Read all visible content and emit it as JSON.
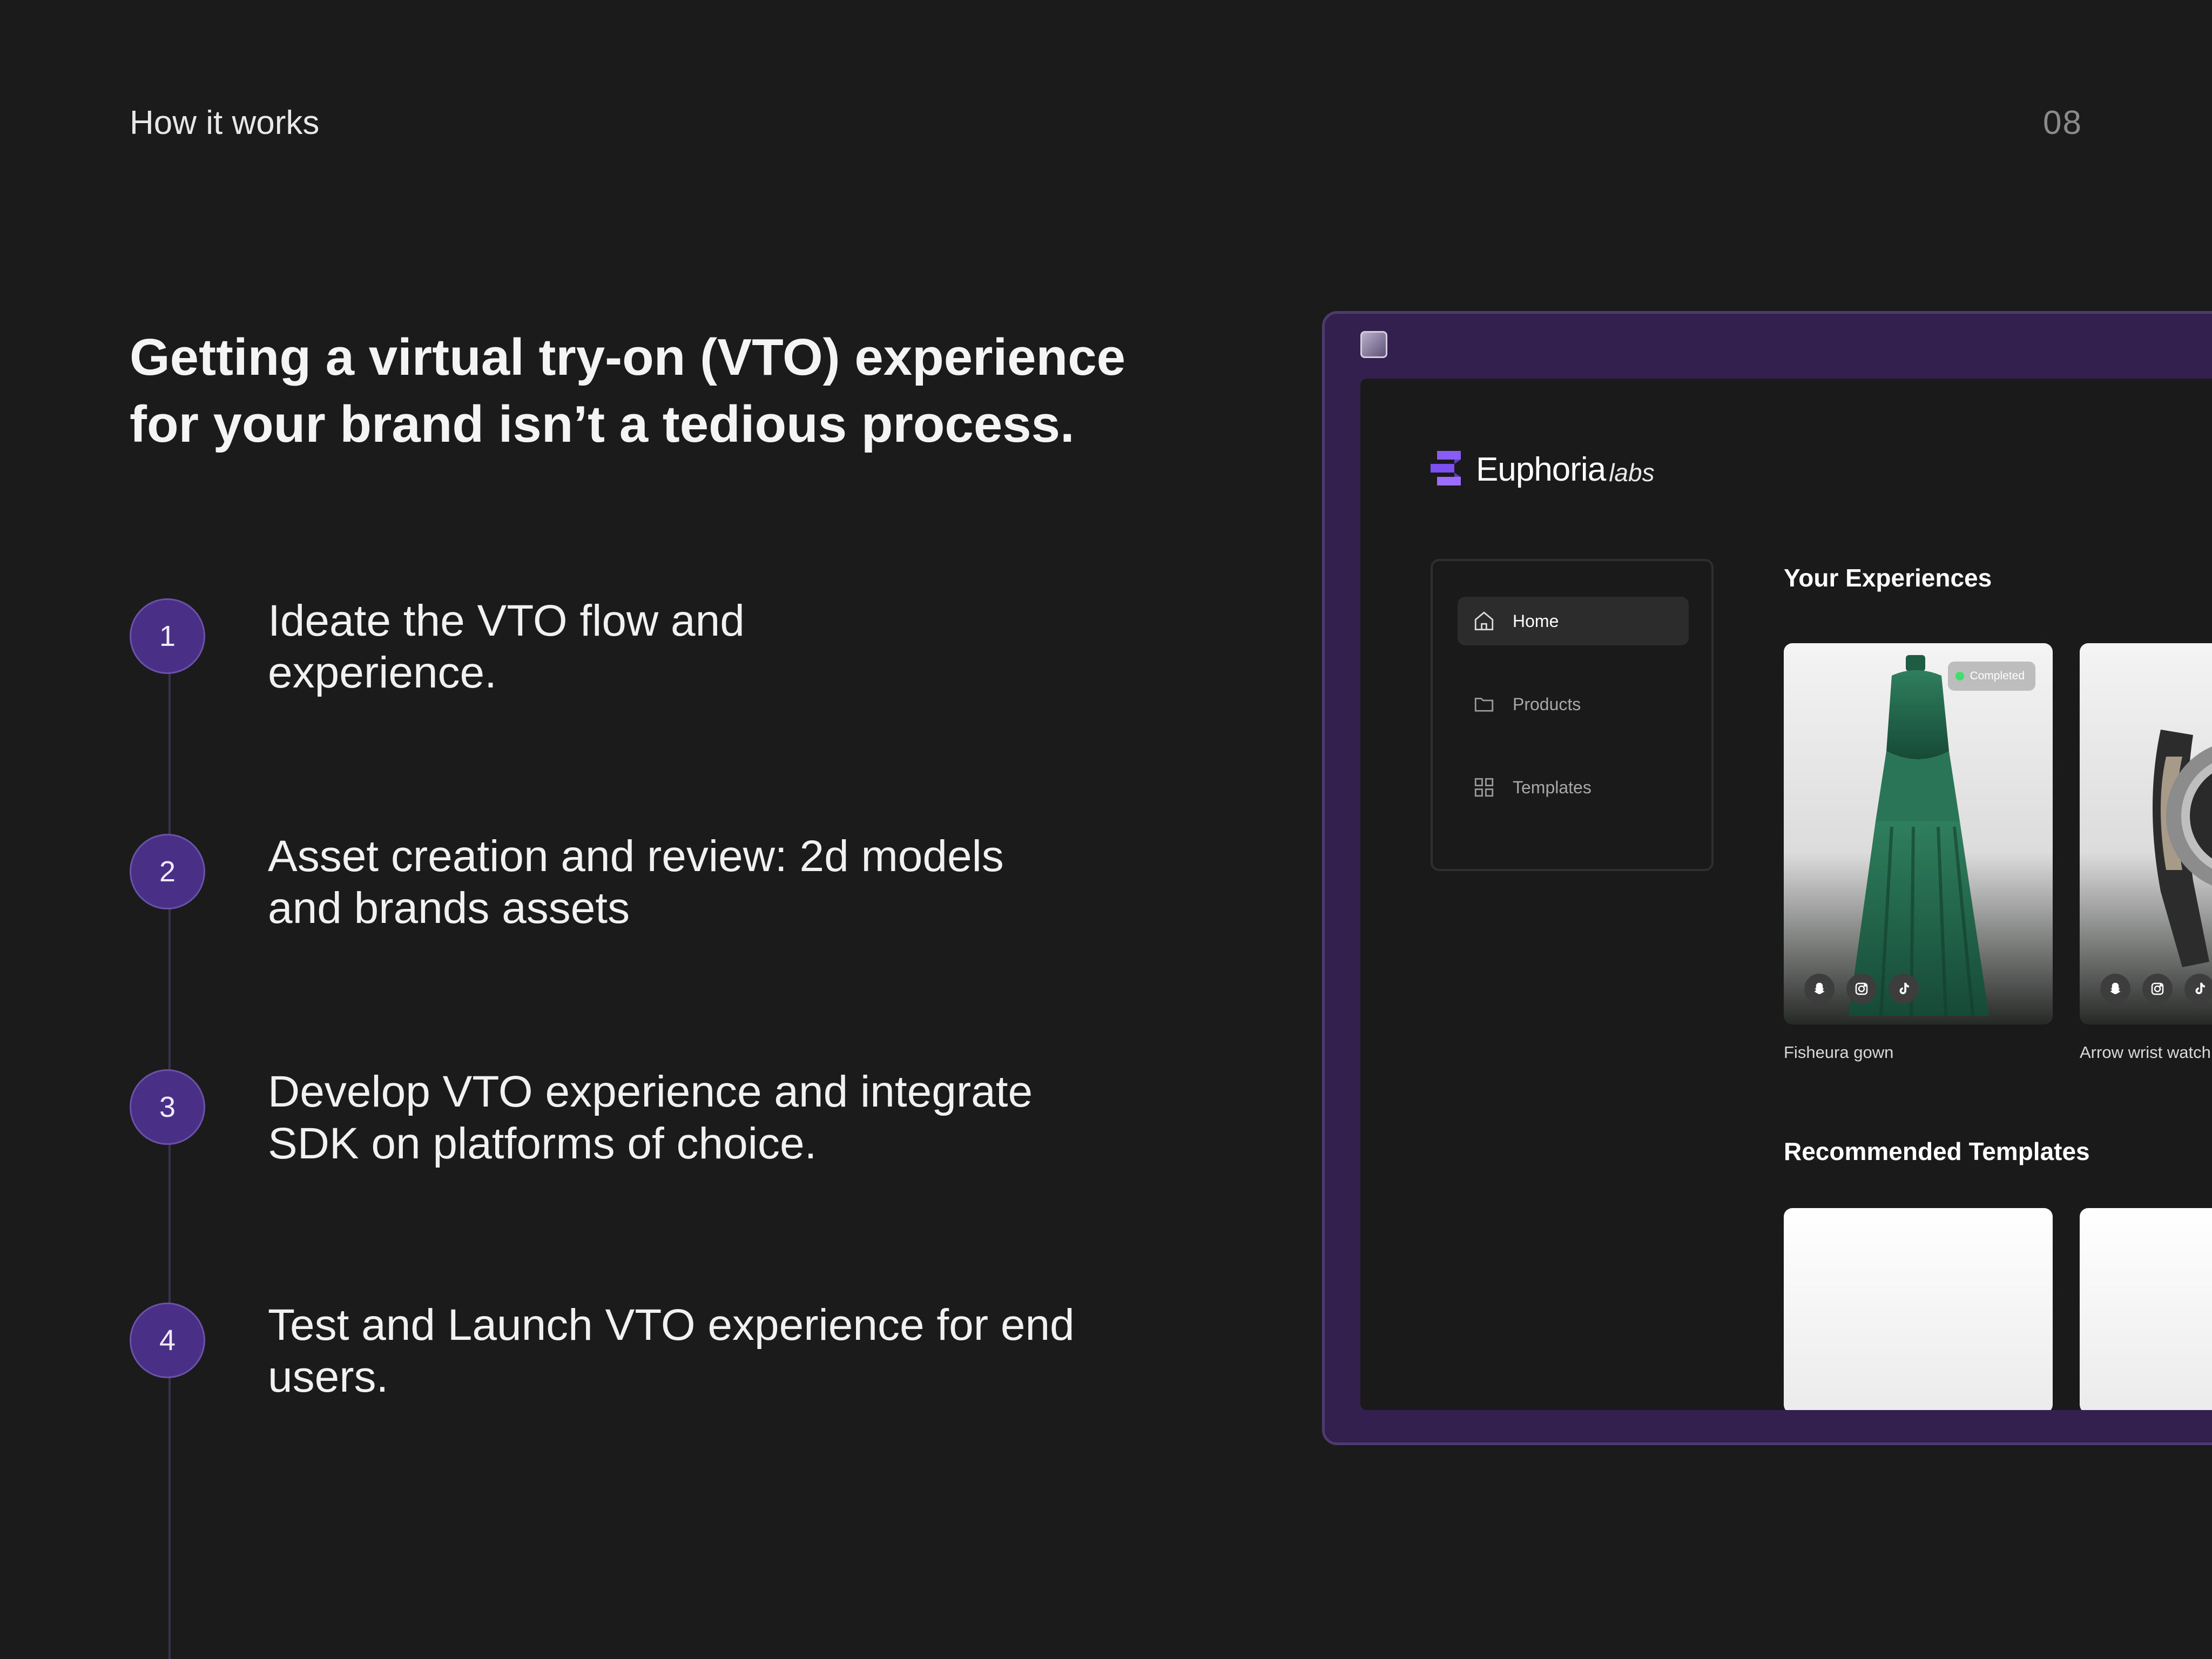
{
  "slide": {
    "section_label": "How it works",
    "page_number": "08",
    "headline": "Getting a virtual try-on (VTO) experience for your brand isn’t a tedious process."
  },
  "steps": [
    {
      "number": "1",
      "text": "Ideate the VTO flow and experience."
    },
    {
      "number": "2",
      "text": "Asset creation and review: 2d models and brands assets"
    },
    {
      "number": "3",
      "text": "Develop VTO experience and integrate SDK on platforms of choice."
    },
    {
      "number": "4",
      "text": "Test and Launch VTO experience for end users."
    }
  ],
  "app": {
    "logo": {
      "name": "Euphoria",
      "suffix": "labs"
    },
    "nav": [
      {
        "label": "Home",
        "icon": "home-icon",
        "active": true
      },
      {
        "label": "Products",
        "icon": "folder-icon",
        "active": false
      },
      {
        "label": "Templates",
        "icon": "grid-icon",
        "active": false
      }
    ],
    "experiences_heading": "Your Experiences",
    "experiences": [
      {
        "title": "Fisheura gown",
        "status": "Completed",
        "image": "green ruffled gown"
      },
      {
        "title": "Arrow wrist watch",
        "image": "wrist watch"
      }
    ],
    "social_icons": [
      "snapchat-icon",
      "instagram-icon",
      "tiktok-icon"
    ],
    "templates_heading": "Recommended Templates"
  },
  "colors": {
    "background": "#1b1b1b",
    "accent_purple": "#4a2f86",
    "frame_purple": "#34204f",
    "status_green": "#3ee06a"
  }
}
